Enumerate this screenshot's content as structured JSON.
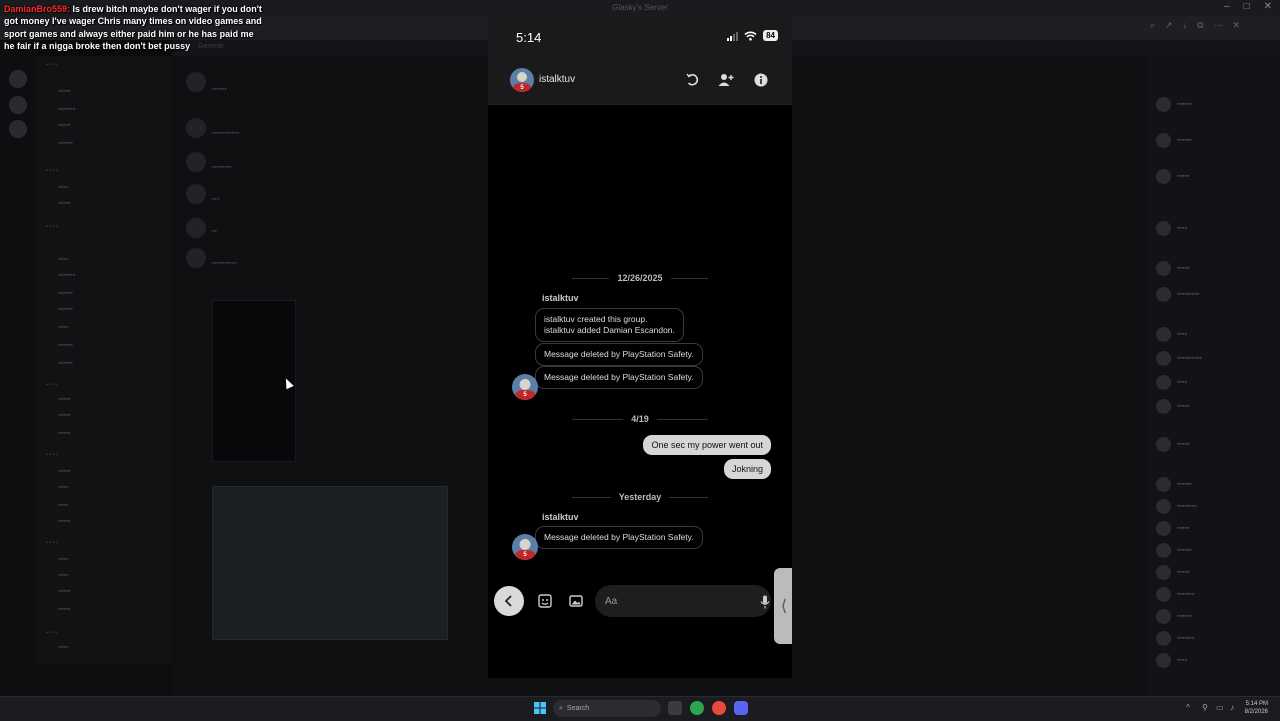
{
  "overlay": {
    "username": "DamianBro559:",
    "message": " Is drew bitch maybe don't wager if you don't got money I've wager Chris many times on video games and sport games and always either paid him or he has paid me he fair if a nigga broke then don't bet pussy"
  },
  "background_window": {
    "title": "Glasky's Server",
    "channel_name": "General"
  },
  "phone": {
    "time": "5:14",
    "battery": "84",
    "header": {
      "name": "istalktuv"
    },
    "avatar_number": "5",
    "messages": {
      "date1": "12/26/2025",
      "sender1": "istalktuv",
      "system_line1": "istalktuv created this group.",
      "system_line2": "istalktuv added Damian Escandon.",
      "deleted1": "Message deleted by PlayStation Safety.",
      "deleted2": "Message deleted by PlayStation Safety.",
      "date2": "4/19",
      "out1": "One sec my power went out",
      "out2": "Jokning",
      "date3": "Yesterday",
      "sender2": "istalktuv",
      "deleted3": "Message deleted by PlayStation Safety."
    },
    "composer": {
      "placeholder": "Aa"
    }
  },
  "taskbar": {
    "search_label": "Search",
    "clock_time": "5:14 PM",
    "clock_date": "8/2/2026"
  },
  "colors": {
    "overlay_user": "#ff2a2a",
    "bubble_out": "#d6d6d6",
    "avatar_shirt": "#c0272d"
  }
}
